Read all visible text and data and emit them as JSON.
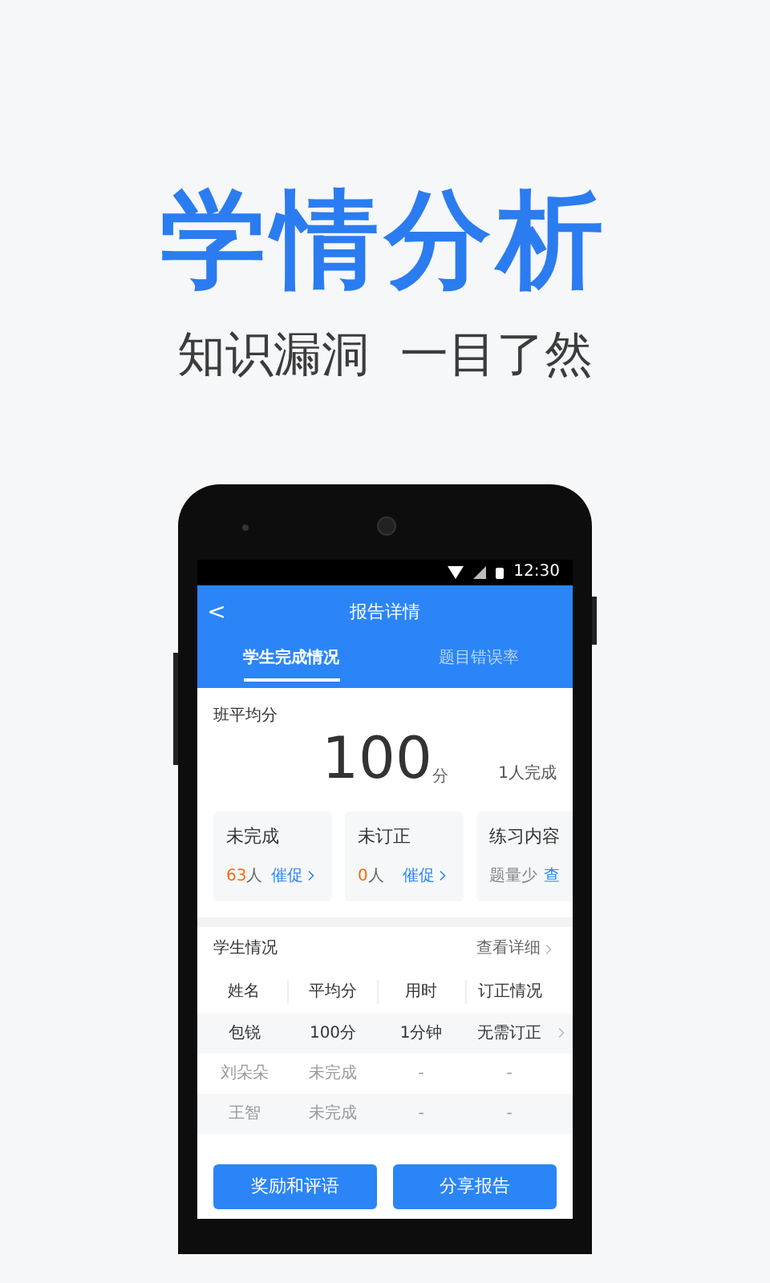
{
  "headline": "学情分析",
  "subheadline": "知识漏洞  一目了然",
  "status_bar": {
    "time": "12:30"
  },
  "header": {
    "back": "<",
    "title": "报告详情"
  },
  "tabs": [
    {
      "label": "学生完成情况",
      "selected": true
    },
    {
      "label": "题目错误率",
      "selected": false
    }
  ],
  "summary": {
    "label": "班平均分",
    "score": "100",
    "unit": "分",
    "completed": "1人完成"
  },
  "cards": [
    {
      "title": "未完成",
      "count": "63",
      "count_unit": "人",
      "action": "催促"
    },
    {
      "title": "未订正",
      "count": "0",
      "count_unit": "人",
      "action": "催促"
    },
    {
      "title": "练习内容",
      "note": "题量少",
      "action": "查"
    }
  ],
  "students": {
    "title": "学生情况",
    "link": "查看详细",
    "columns": [
      "姓名",
      "平均分",
      "用时",
      "订正情况"
    ],
    "rows": [
      {
        "cells": [
          "包锐",
          "100分",
          "1分钟",
          "无需订正"
        ],
        "completed": true
      },
      {
        "cells": [
          "刘朵朵",
          "未完成",
          "-",
          "-"
        ],
        "completed": false
      },
      {
        "cells": [
          "王智",
          "未完成",
          "-",
          "-"
        ],
        "completed": false
      }
    ]
  },
  "buttons": [
    "奖励和评语",
    "分享报告"
  ]
}
